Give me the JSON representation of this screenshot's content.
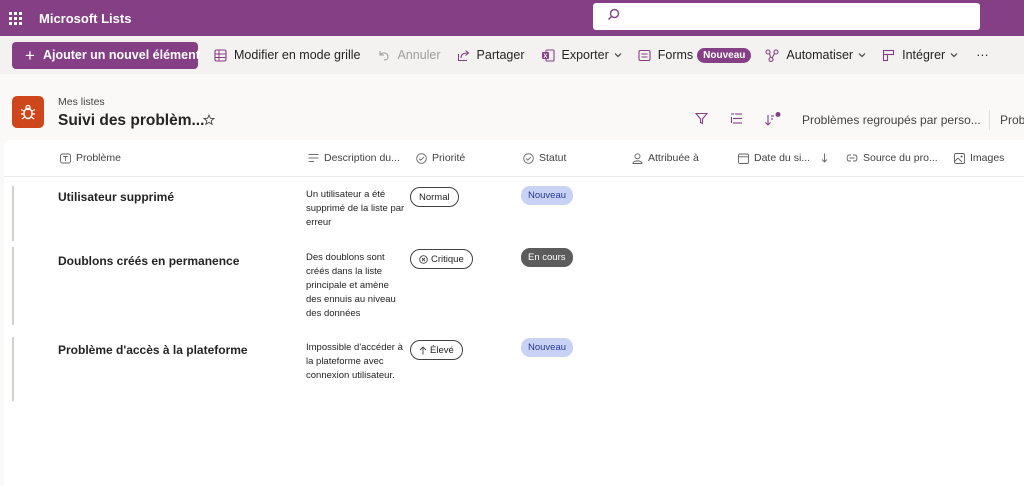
{
  "app": {
    "title": "Microsoft Lists"
  },
  "search": {
    "placeholder": ""
  },
  "commands": {
    "add_new": "Ajouter un nouvel élément",
    "grid_edit": "Modifier en mode grille",
    "undo": "Annuler",
    "share": "Partager",
    "export": "Exporter",
    "forms": "Forms",
    "forms_badge": "Nouveau",
    "automate": "Automatiser",
    "integrate": "Intégrer",
    "more": "···"
  },
  "header": {
    "breadcrumb": "Mes listes",
    "title": "Suivi des problèm...",
    "view_name": "Problèmes regroupés par perso...",
    "view_next": "Prob"
  },
  "columns": {
    "problem": "Problème",
    "description": "Description du...",
    "priority": "Priorité",
    "status": "Statut",
    "assigned": "Attribuée à",
    "date": "Date du si...",
    "source": "Source du pro...",
    "images": "Images"
  },
  "rows": [
    {
      "title": "Utilisateur supprimé",
      "description": "Un utilisateur a été supprimé de la liste par erreur",
      "priority": "Normal",
      "priority_icon": "none",
      "status": "Nouveau"
    },
    {
      "title": "Doublons créés en permanence",
      "description": "Des doublons sont créés dans la liste principale et amène des ennuis au niveau des données",
      "priority": "Critique",
      "priority_icon": "critical-icon",
      "status": "En cours"
    },
    {
      "title": "Problème d'accès à la plateforme",
      "description": "Impossible d'accéder à la plateforme avec connexion utilisateur.",
      "priority": "Élevé",
      "priority_icon": "arrow-up-icon",
      "status": "Nouveau"
    }
  ],
  "colors": {
    "brand": "#854085",
    "status_new_bg": "#c7d2f5",
    "status_progress_bg": "#5c5c5c",
    "list_icon_bg": "#d0461c"
  }
}
